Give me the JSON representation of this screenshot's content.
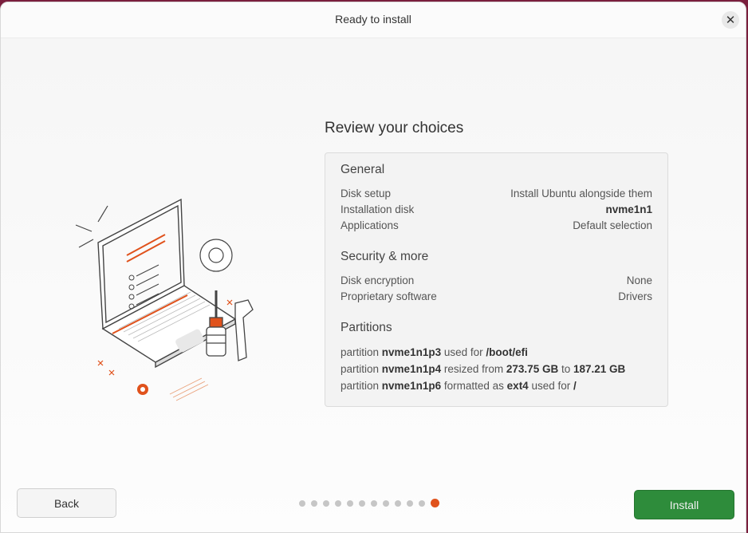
{
  "window": {
    "title": "Ready to install",
    "close_icon": "close-icon"
  },
  "heading": "Review your choices",
  "general": {
    "title": "General",
    "rows": [
      {
        "label": "Disk setup",
        "value": "Install Ubuntu alongside them"
      },
      {
        "label": "Installation disk",
        "value": "nvme1n1"
      },
      {
        "label": "Applications",
        "value": "Default selection"
      }
    ]
  },
  "security": {
    "title": "Security & more",
    "rows": [
      {
        "label": "Disk encryption",
        "value": "None"
      },
      {
        "label": "Proprietary software",
        "value": "Drivers"
      }
    ]
  },
  "partitions": {
    "title": "Partitions",
    "lines": [
      {
        "w1": "partition",
        "dev": "nvme1n1p3",
        "w2": "used for",
        "target": "/boot/efi"
      },
      {
        "w1": "partition",
        "dev": "nvme1n1p4",
        "w2": "resized from",
        "from": "273.75 GB",
        "w3": "to",
        "to": "187.21 GB"
      },
      {
        "w1": "partition",
        "dev": "nvme1n1p6",
        "w2": "formatted as",
        "fs": "ext4",
        "w3": "used for",
        "target": "/"
      }
    ]
  },
  "footer": {
    "back_label": "Back",
    "install_label": "Install",
    "page_total": 12,
    "page_current": 12
  },
  "colors": {
    "accent": "#e0521c",
    "install_green": "#2e8c3b",
    "desktop": "#7a1f3d"
  }
}
